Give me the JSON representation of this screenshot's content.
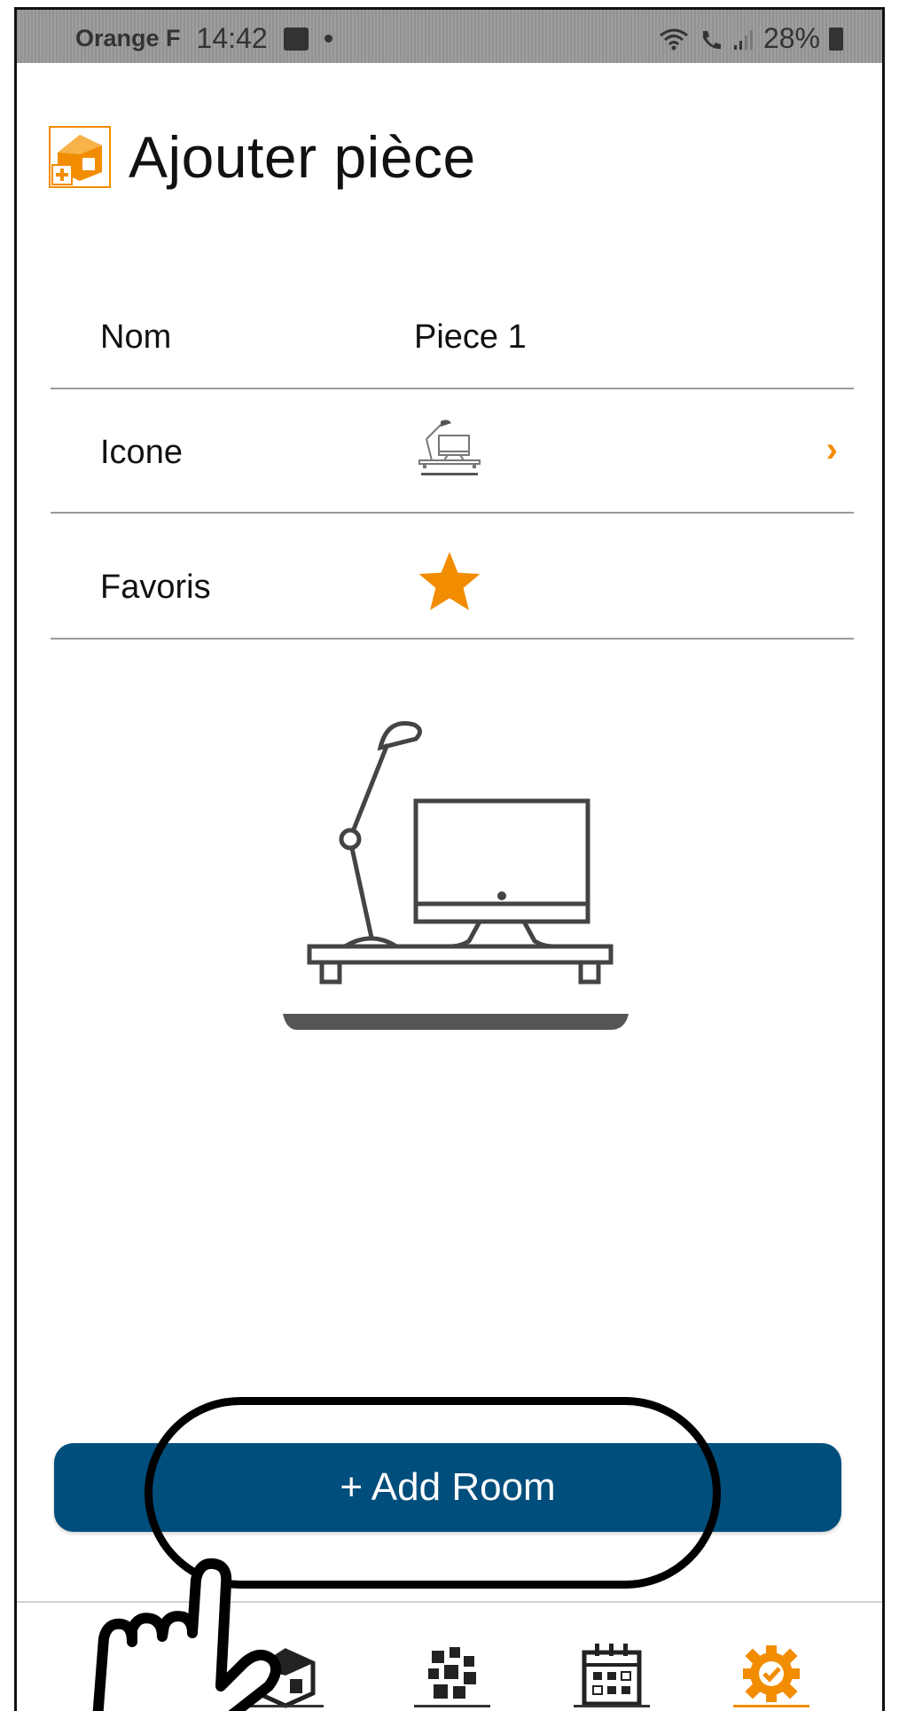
{
  "status_bar": {
    "carrier": "Orange F",
    "time": "14:42",
    "battery": "28%"
  },
  "header": {
    "title": "Ajouter pièce",
    "icon": "add-room-icon"
  },
  "form": {
    "name": {
      "label": "Nom",
      "value": "Piece 1"
    },
    "icon": {
      "label": "Icone",
      "value_icon": "desk-lamp-computer-icon",
      "chevron": "›"
    },
    "favorite": {
      "label": "Favoris",
      "value_icon": "star-icon",
      "checked": true
    }
  },
  "actions": {
    "add_room_label": "+ Add Room"
  },
  "bottom_nav": {
    "items": [
      {
        "icon": "home-icon"
      },
      {
        "icon": "rooms-icon"
      },
      {
        "icon": "scenes-icon"
      },
      {
        "icon": "calendar-icon"
      },
      {
        "icon": "settings-gear-icon",
        "active": true
      }
    ]
  },
  "colors": {
    "accent": "#f28c00",
    "primary": "#004e7c",
    "status_bar": "#9a9a9a"
  }
}
